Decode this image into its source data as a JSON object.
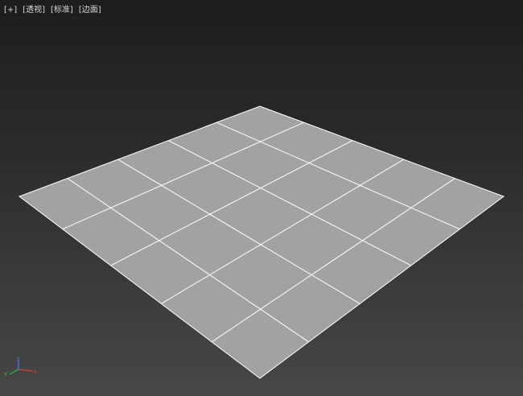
{
  "viewport": {
    "labels": [
      "[+]",
      "[透视]",
      "[标准]",
      "[边面]"
    ]
  },
  "colors": {
    "plane_fill": "#a2a2a2",
    "grid_lines": "#ffffff",
    "axis_x": "#d83a3a",
    "axis_y": "#2fbf3a",
    "axis_z": "#4a78ff"
  },
  "gizmo": {
    "x": "x",
    "y": "y",
    "z": "z"
  }
}
